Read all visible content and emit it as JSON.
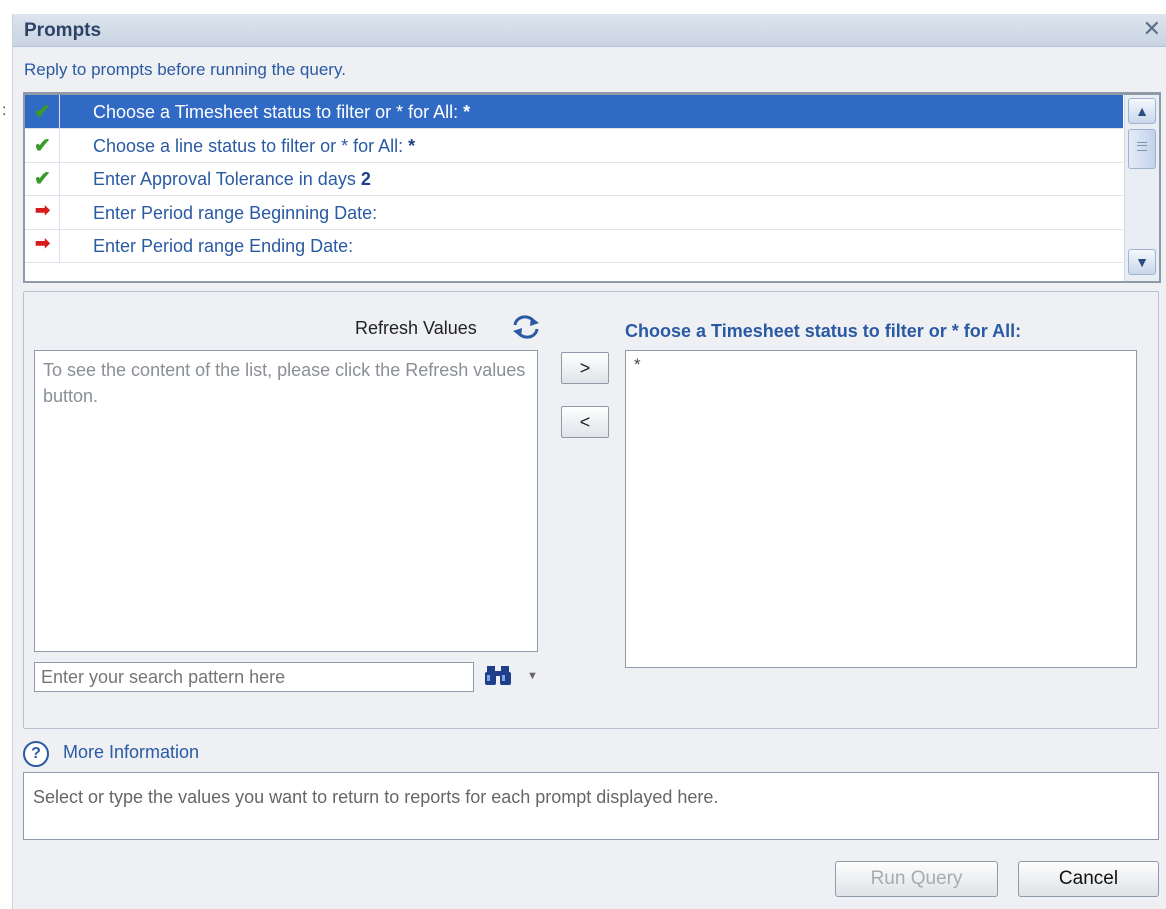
{
  "dialog": {
    "title": "Prompts",
    "close_label": "✕",
    "subtitle": "Reply to prompts before running the query.",
    "left_edge_mark": ":"
  },
  "prompts": [
    {
      "status": "done",
      "text": "Choose a Timesheet status to filter or * for All: ",
      "value": "*",
      "selected": true
    },
    {
      "status": "done",
      "text": "Choose a line status to filter or * for All: ",
      "value": "*",
      "selected": false
    },
    {
      "status": "done",
      "text": "Enter Approval Tolerance in days ",
      "value": "2",
      "selected": false
    },
    {
      "status": "pending",
      "text": "Enter Period range Beginning Date:",
      "value": "",
      "selected": false
    },
    {
      "status": "pending",
      "text": "Enter Period range Ending Date:",
      "value": "",
      "selected": false
    }
  ],
  "scrollbar": {
    "up": "▲",
    "down": "▼"
  },
  "values_panel": {
    "refresh_label": "Refresh Values",
    "left_hint": "To see the content of the list, please click the Refresh values button.",
    "search_placeholder": "Enter your search pattern here",
    "add_label": ">",
    "remove_label": "<",
    "right_title": "Choose a Timesheet status to filter or * for All:",
    "selected_values": [
      "*"
    ]
  },
  "more_info_label": "More Information",
  "help_glyph": "?",
  "info_text": "Select or type the values you want to return to reports for each prompt displayed here.",
  "buttons": {
    "run_query": "Run Query",
    "cancel": "Cancel"
  }
}
